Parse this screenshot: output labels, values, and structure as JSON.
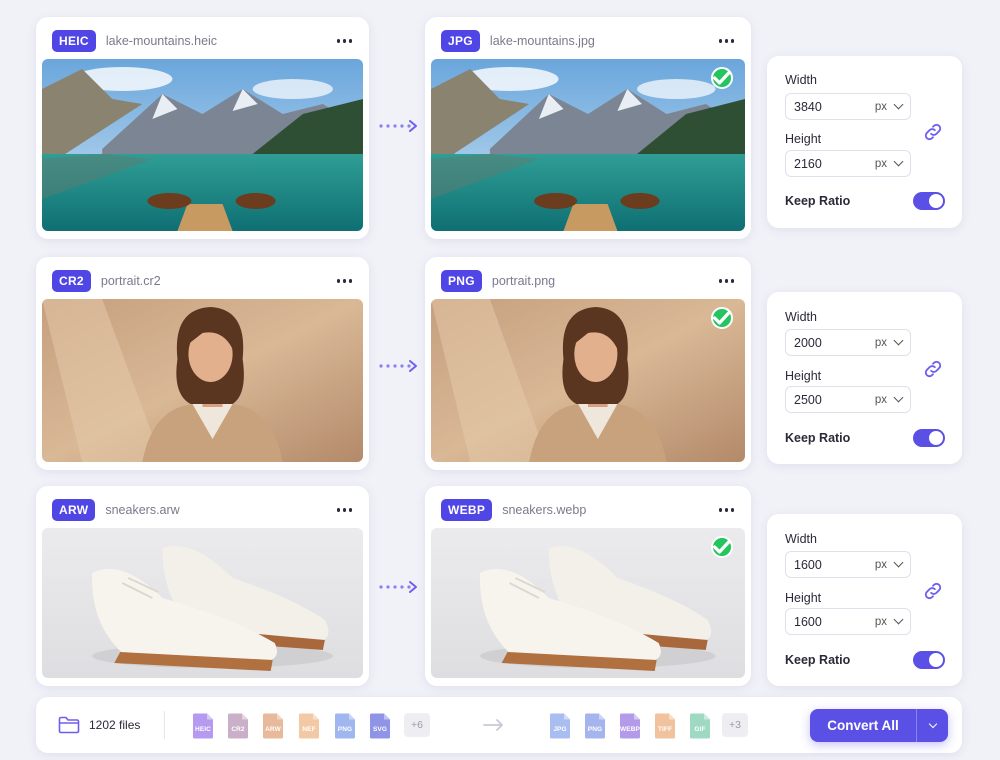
{
  "rows": [
    {
      "source": {
        "format": "HEIC",
        "filename": "lake-mountains.heic"
      },
      "target": {
        "format": "JPG",
        "filename": "lake-mountains.jpg"
      },
      "dims": {
        "width_label": "Width",
        "width": "3840",
        "height_label": "Height",
        "height": "2160",
        "unit": "px",
        "keep_ratio_label": "Keep Ratio"
      }
    },
    {
      "source": {
        "format": "CR2",
        "filename": "portrait.cr2"
      },
      "target": {
        "format": "PNG",
        "filename": "portrait.png"
      },
      "dims": {
        "width_label": "Width",
        "width": "2000",
        "height_label": "Height",
        "height": "2500",
        "unit": "px",
        "keep_ratio_label": "Keep Ratio"
      }
    },
    {
      "source": {
        "format": "ARW",
        "filename": "sneakers.arw"
      },
      "target": {
        "format": "WEBP",
        "filename": "sneakers.webp"
      },
      "dims": {
        "width_label": "Width",
        "width": "1600",
        "height_label": "Height",
        "height": "1600",
        "unit": "px",
        "keep_ratio_label": "Keep Ratio"
      }
    }
  ],
  "footer": {
    "file_count": "1202 files",
    "input_formats": [
      "HEIC",
      "CR2",
      "ARW",
      "NEF",
      "PNG",
      "SVG"
    ],
    "input_more": "+6",
    "output_formats": [
      "JPG",
      "PNG",
      "WEBP",
      "TIFF",
      "GIF"
    ],
    "output_more": "+3",
    "convert_label": "Convert All"
  },
  "colors": {
    "accent": "#5b50e6",
    "badge": "#4f46e5",
    "success": "#22c55e"
  },
  "icons": [
    "more-icon",
    "arrow-right-icon",
    "check-icon",
    "link-icon",
    "chevron-down-icon",
    "folder-icon",
    "file-icon"
  ]
}
